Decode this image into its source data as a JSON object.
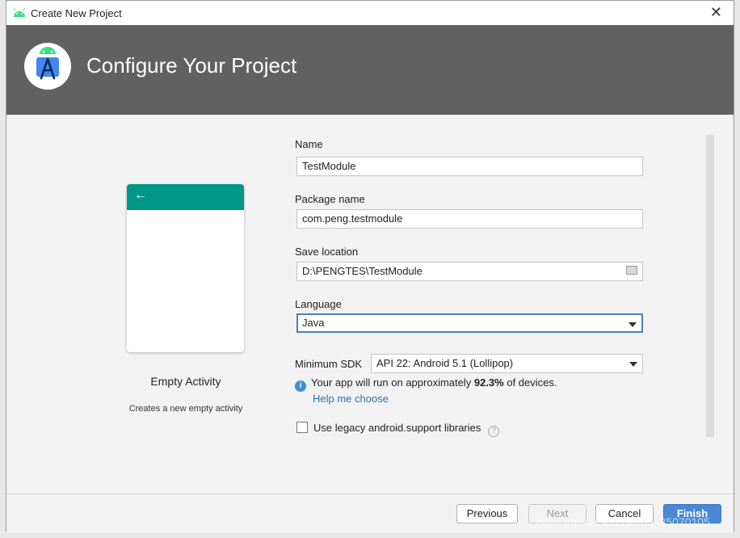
{
  "window": {
    "title": "Create New Project",
    "close_glyph": "✕"
  },
  "banner": {
    "heading": "Configure Your Project"
  },
  "template": {
    "back_glyph": "←",
    "name": "Empty Activity",
    "description": "Creates a new empty activity",
    "appbar_color": "#009688"
  },
  "form": {
    "name_label": "Name",
    "name_value": "TestModule",
    "package_label": "Package name",
    "package_value": "com.peng.testmodule",
    "location_label": "Save location",
    "location_value": "D:\\PENGTES\\TestModule",
    "language_label": "Language",
    "language_value": "Java",
    "min_sdk_label": "Minimum SDK",
    "min_sdk_value": "API 22: Android 5.1 (Lollipop)",
    "info_prefix": "Your app will run on approximately ",
    "info_percent": "92.3%",
    "info_suffix": " of devices.",
    "help_link": "Help me choose",
    "legacy_label": "Use legacy android.support libraries",
    "legacy_checked": false
  },
  "footer": {
    "previous": "Previous",
    "next": "Next",
    "cancel": "Cancel",
    "finish": "Finish"
  },
  "watermark": "https://blog.csdn.net/qq_35070105",
  "colors": {
    "banner": "#616161",
    "accent": "#4a89d6",
    "link": "#2f6fb0"
  }
}
